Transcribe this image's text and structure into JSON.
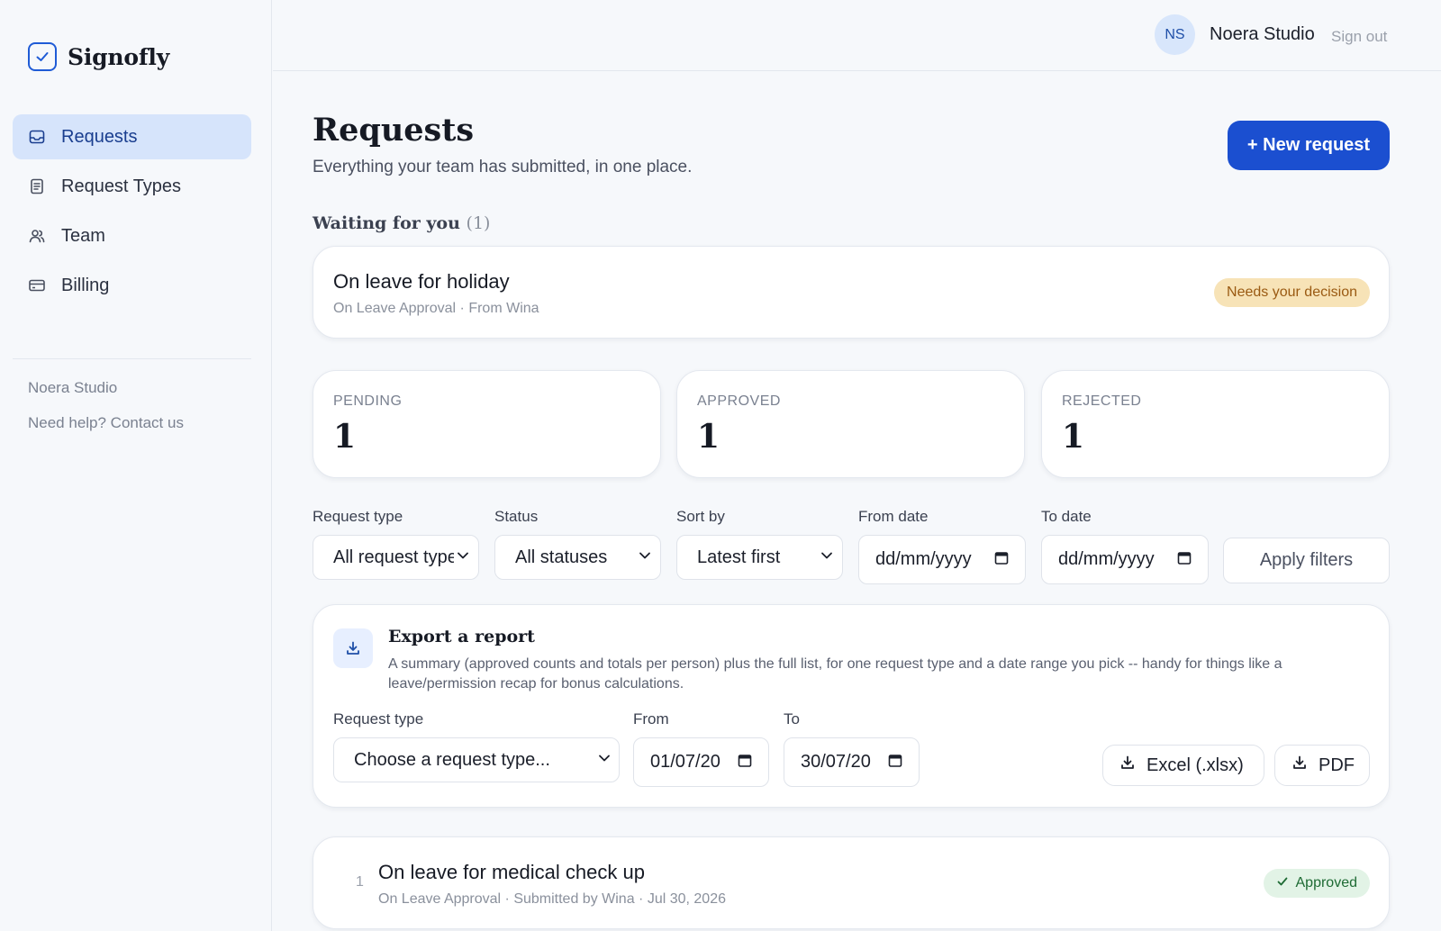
{
  "app": {
    "name": "Signofly"
  },
  "sidebar": {
    "items": [
      {
        "label": "Requests",
        "icon": "inbox-icon",
        "active": true
      },
      {
        "label": "Request Types",
        "icon": "document-icon"
      },
      {
        "label": "Team",
        "icon": "users-icon"
      },
      {
        "label": "Billing",
        "icon": "credit-card-icon"
      }
    ],
    "org_name": "Noera Studio",
    "help_text": "Need help? Contact us"
  },
  "header": {
    "avatar_initials": "NS",
    "user_name": "Noera Studio",
    "signout_label": "Sign out"
  },
  "main": {
    "title": "Requests",
    "subtitle": "Everything your team has submitted, in one place.",
    "new_request_label": "+ New request",
    "waiting": {
      "heading": "Waiting for you",
      "count": "(1)",
      "card": {
        "title": "On leave for holiday",
        "meta": "On Leave Approval · From Wina",
        "badge": "Needs your decision"
      }
    },
    "stats": [
      {
        "label": "PENDING",
        "value": "1"
      },
      {
        "label": "APPROVED",
        "value": "1"
      },
      {
        "label": "REJECTED",
        "value": "1"
      }
    ],
    "filters": {
      "request_type": {
        "label": "Request type",
        "value": "All request types"
      },
      "status": {
        "label": "Status",
        "value": "All statuses"
      },
      "sort_by": {
        "label": "Sort by",
        "value": "Latest first"
      },
      "from_date": {
        "label": "From date",
        "value": "dd/mm/yyyy"
      },
      "to_date": {
        "label": "To date",
        "value": "dd/mm/yyyy"
      },
      "apply_label": "Apply filters"
    },
    "export": {
      "title": "Export a report",
      "description": "A summary (approved counts and totals per person) plus the full list, for one request type and a date range you pick -- handy for things like a leave/permission recap for bonus calculations.",
      "request_type_label": "Request type",
      "request_type_value": "Choose a request type...",
      "from_label": "From",
      "from_value": "01/07/20",
      "to_label": "To",
      "to_value": "30/07/20",
      "excel_label": "Excel (.xlsx)",
      "pdf_label": "PDF"
    },
    "requests": [
      {
        "index": "1",
        "title": "On leave for medical check up",
        "meta": "On Leave Approval · Submitted by Wina · Jul 30, 2026",
        "status": "Approved"
      }
    ]
  },
  "colors": {
    "accent": "#1b4fd0",
    "nav_active_bg": "#d6e4fb",
    "amber_badge_bg": "#f7e3b7",
    "green_badge_bg": "#e2f3e6"
  }
}
